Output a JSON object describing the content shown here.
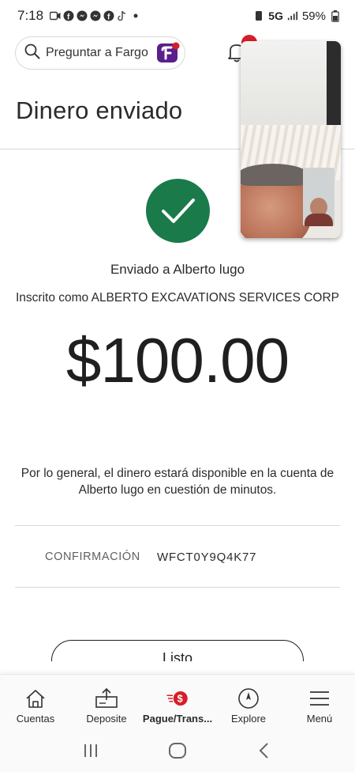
{
  "status_bar": {
    "time": "7:18",
    "network": "5G",
    "battery": "59%",
    "icons": [
      "video-call-icon",
      "facebook-icon",
      "messenger-icon",
      "messenger-icon",
      "facebook-icon",
      "tiktok-icon",
      "dot-icon"
    ]
  },
  "header": {
    "search_label": "Preguntar a Fargo",
    "fargo_icon": "fargo-assistant-icon",
    "bell_icon": "bell-icon"
  },
  "page": {
    "title": "Dinero enviado"
  },
  "confirmation": {
    "sent_to": "Enviado a Alberto lugo",
    "enrolled_as": "Inscrito como ALBERTO EXCAVATIONS SERVICES CORP",
    "amount": "$100.00",
    "availability_note": "Por lo general, el dinero estará disponible en la cuenta de Alberto lugo en cuestión de minutos.",
    "confirmation_label": "CONFIRMACIÓN",
    "confirmation_code": "WFCT0Y9Q4K77",
    "done_button": "Listo"
  },
  "bottom_nav": {
    "items": [
      {
        "label": "Cuentas",
        "icon": "house-icon"
      },
      {
        "label": "Deposite",
        "icon": "deposit-check-icon"
      },
      {
        "label": "Pague/Trans...",
        "icon": "pay-transfer-icon",
        "active": true
      },
      {
        "label": "Explore",
        "icon": "compass-icon"
      },
      {
        "label": "Menú",
        "icon": "hamburger-icon"
      }
    ]
  },
  "colors": {
    "success_green": "#1a7a4a",
    "brand_red": "#d71e28",
    "fargo_purple": "#5a1f8c"
  }
}
